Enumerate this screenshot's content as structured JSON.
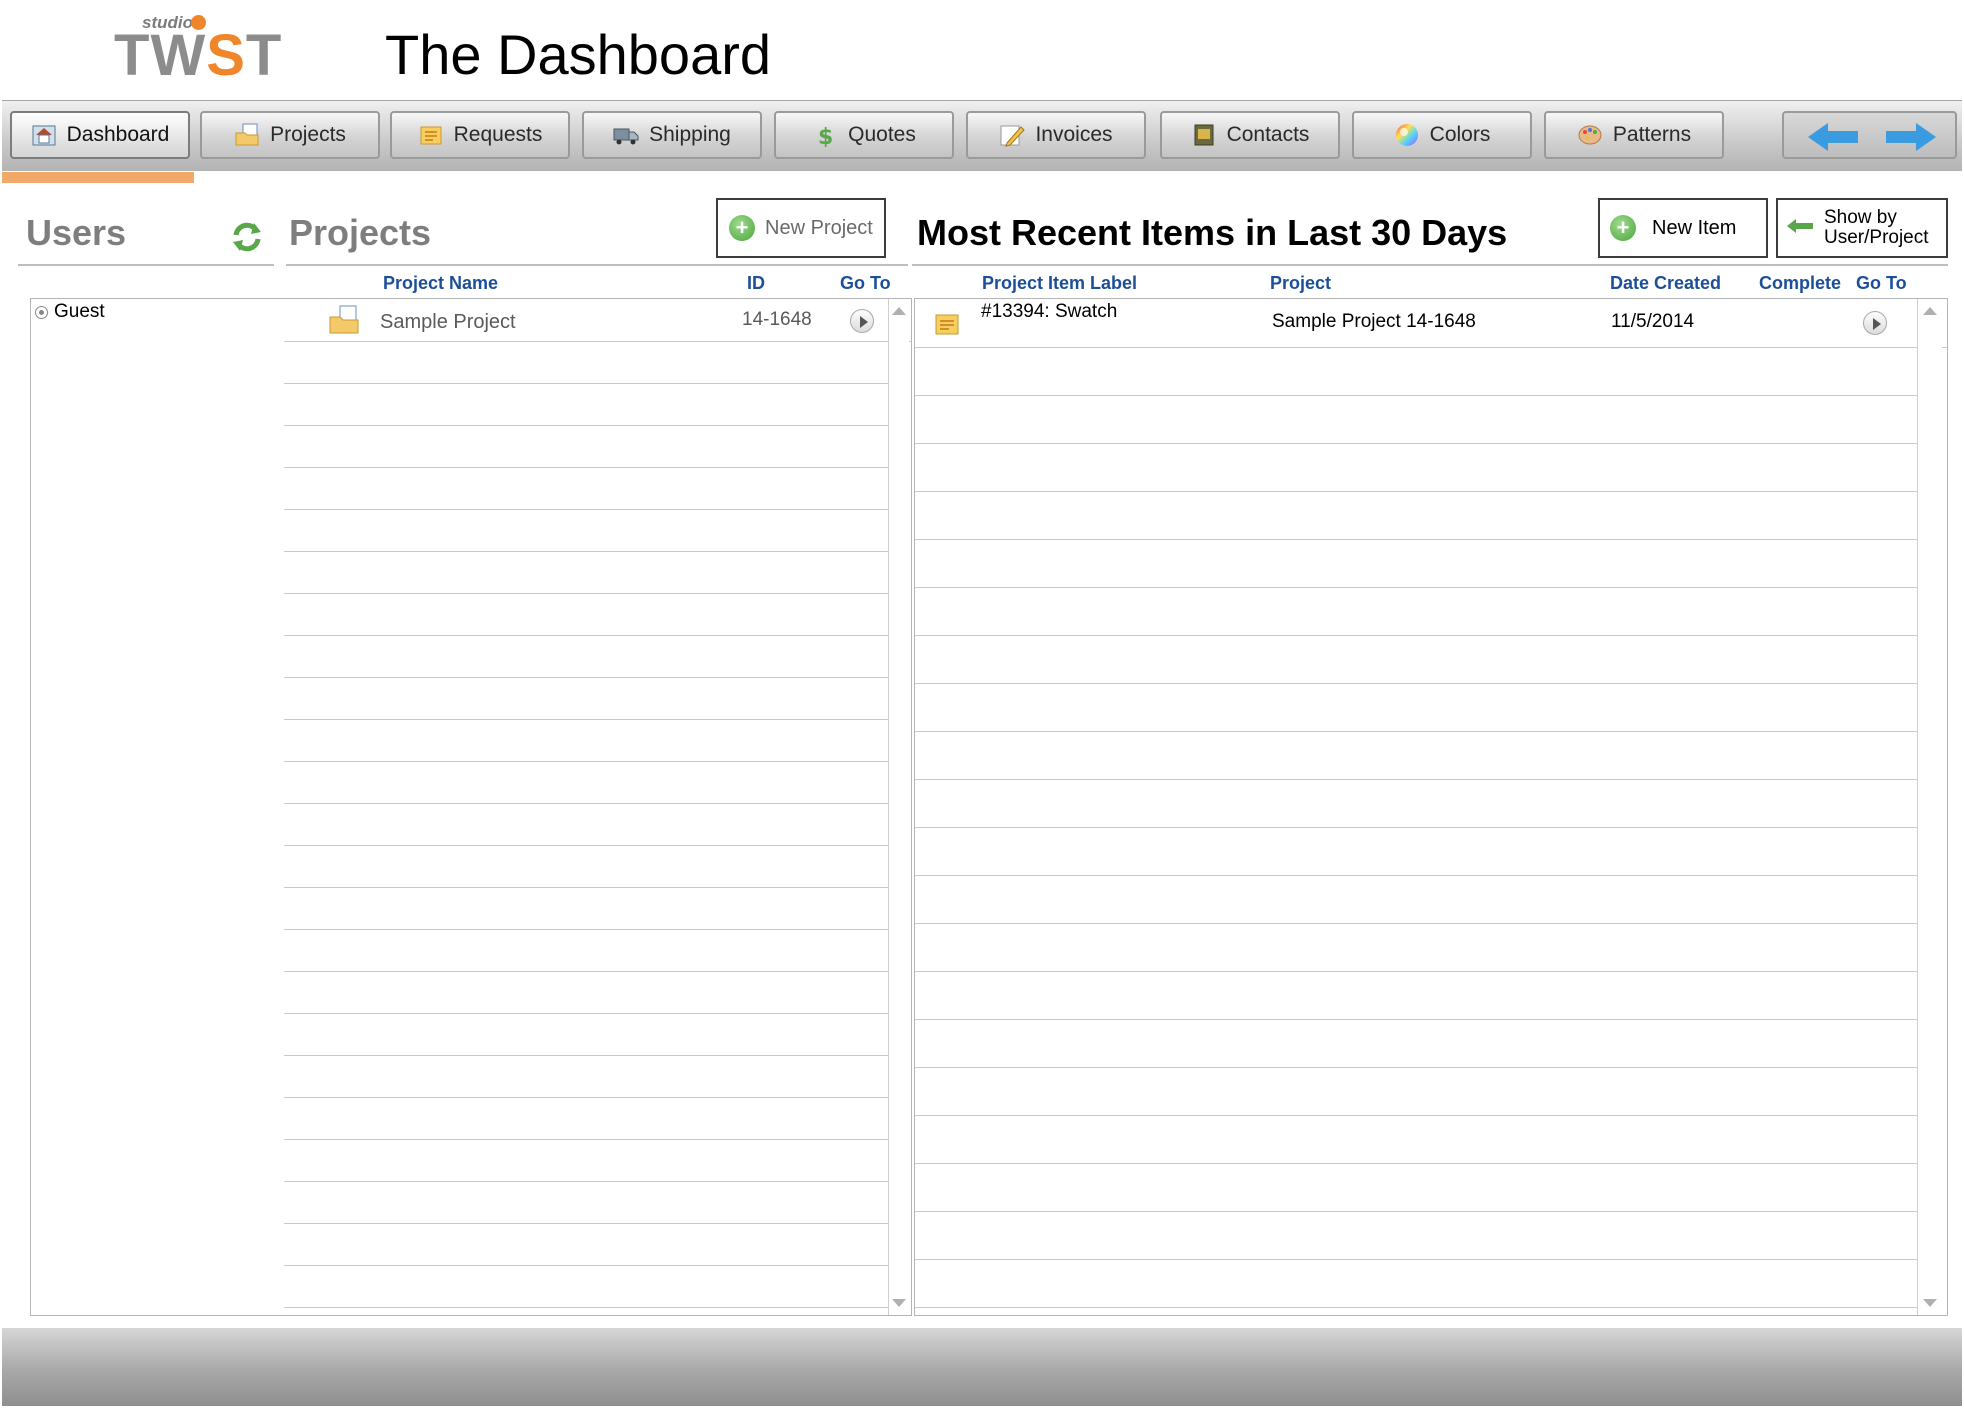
{
  "header": {
    "logo_small": "studio",
    "logo_main": "TWST",
    "title": "The Dashboard"
  },
  "nav": {
    "tabs": [
      {
        "label": "Dashboard",
        "icon": "home-icon",
        "active": true
      },
      {
        "label": "Projects",
        "icon": "folder-icon",
        "active": false
      },
      {
        "label": "Requests",
        "icon": "request-note-icon",
        "active": false
      },
      {
        "label": "Shipping",
        "icon": "truck-icon",
        "active": false
      },
      {
        "label": "Quotes",
        "icon": "dollar-icon",
        "active": false
      },
      {
        "label": "Invoices",
        "icon": "pencil-icon",
        "active": false
      },
      {
        "label": "Contacts",
        "icon": "address-book-icon",
        "active": false
      },
      {
        "label": "Colors",
        "icon": "color-wheel-icon",
        "active": false
      },
      {
        "label": "Patterns",
        "icon": "palette-icon",
        "active": false
      }
    ],
    "arrow_color": "#3a9be0"
  },
  "users": {
    "title": "Users",
    "items": [
      "Guest"
    ]
  },
  "projects": {
    "title": "Projects",
    "new_button": "New Project",
    "columns": [
      "Project Name",
      "ID",
      "Go To"
    ],
    "rows": [
      {
        "name": "Sample Project",
        "id": "14-1648"
      }
    ]
  },
  "recent": {
    "title": "Most Recent Items in Last 30 Days",
    "new_button": "New Item",
    "show_by_button_line1": "Show by",
    "show_by_button_line2": "User/Project",
    "columns": [
      "Project Item Label",
      "Project",
      "Date Created",
      "Complete",
      "Go To"
    ],
    "rows": [
      {
        "label": "#13394: Swatch",
        "project": "Sample Project 14-1648",
        "date": "11/5/2014"
      }
    ]
  },
  "colors": {
    "accent_orange": "#f0862a",
    "header_blue": "#1d4f99",
    "section_gray": "#7e7e7e"
  }
}
